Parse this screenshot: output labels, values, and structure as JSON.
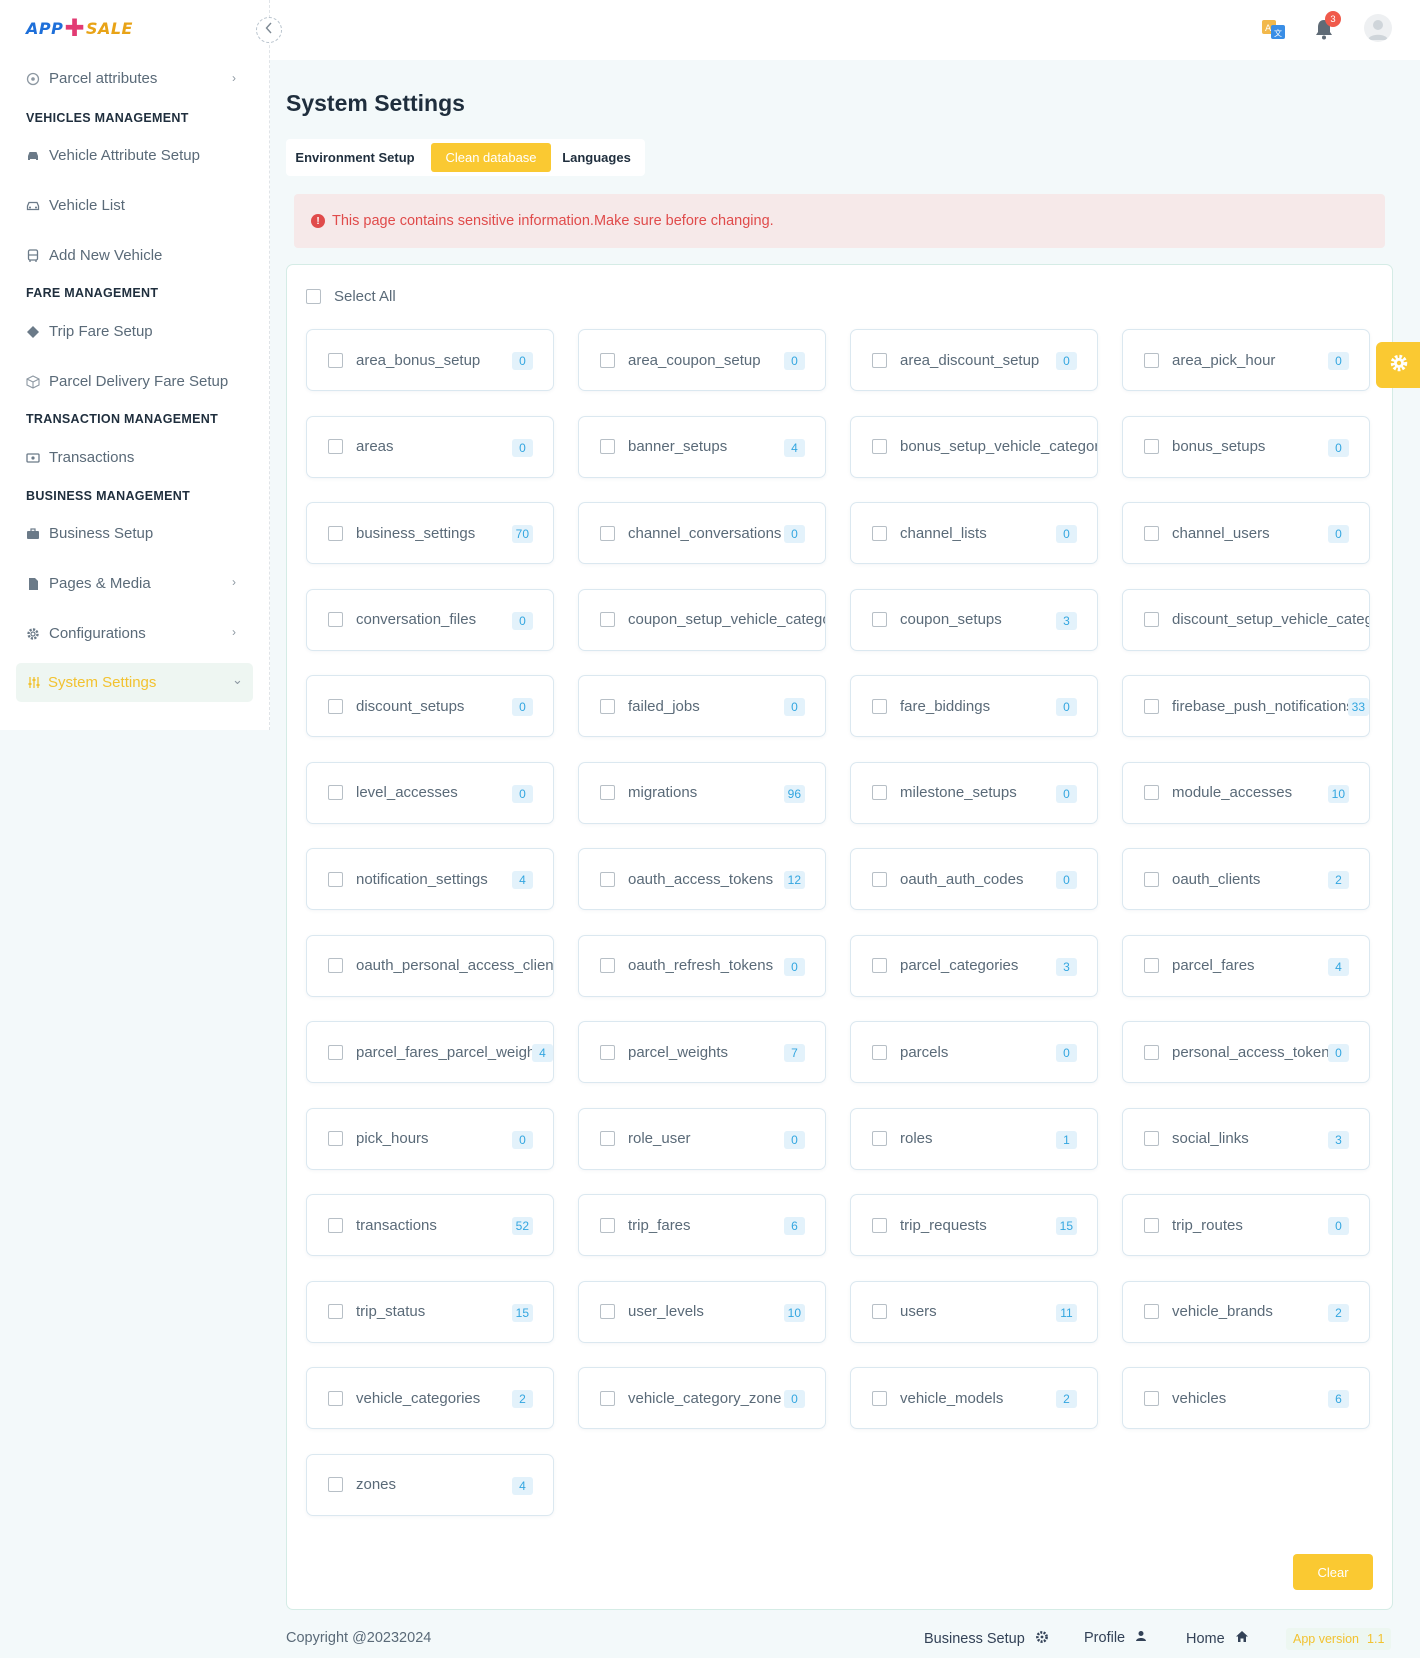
{
  "app": {
    "logo_left": "APP",
    "logo_right": "SALE"
  },
  "sidebar": {
    "items": [
      {
        "label": "Parcel attributes",
        "icon": "circle-plus-icon",
        "chevron": true
      },
      {
        "section": "VEHICLES MANAGEMENT"
      },
      {
        "label": "Vehicle Attribute Setup",
        "icon": "car-icon"
      },
      {
        "label": "Vehicle List",
        "icon": "car-front-icon"
      },
      {
        "label": "Add New Vehicle",
        "icon": "bus-icon"
      },
      {
        "section": "FARE MANAGEMENT"
      },
      {
        "label": "Trip Fare Setup",
        "icon": "diamond-icon"
      },
      {
        "label": "Parcel Delivery Fare Setup",
        "icon": "box-icon"
      },
      {
        "section": "TRANSACTION MANAGEMENT"
      },
      {
        "label": "Transactions",
        "icon": "money-icon"
      },
      {
        "section": "BUSINESS MANAGEMENT"
      },
      {
        "label": "Business Setup",
        "icon": "briefcase-icon"
      },
      {
        "label": "Pages & Media",
        "icon": "pages-icon",
        "chevron": true
      },
      {
        "label": "Configurations",
        "icon": "cog-icon",
        "chevron": true
      },
      {
        "label": "System Settings",
        "icon": "sliders-icon",
        "active": true
      }
    ]
  },
  "topbar": {
    "notification_count": "3"
  },
  "page": {
    "title": "System Settings",
    "tabs": [
      "Environment Setup",
      "Clean database",
      "Languages"
    ],
    "active_tab": "Clean database",
    "alert": "This page contains sensitive information.Make sure before changing.",
    "select_all": "Select All",
    "clear_button": "Clear"
  },
  "tables": [
    {
      "name": "area_bonus_setup",
      "count": "0"
    },
    {
      "name": "area_coupon_setup",
      "count": "0"
    },
    {
      "name": "area_discount_setup",
      "count": "0"
    },
    {
      "name": "area_pick_hour",
      "count": "0"
    },
    {
      "name": "areas",
      "count": "0"
    },
    {
      "name": "banner_setups",
      "count": "4"
    },
    {
      "name": "bonus_setup_vehicle_category",
      "count": ""
    },
    {
      "name": "bonus_setups",
      "count": "0"
    },
    {
      "name": "business_settings",
      "count": "70"
    },
    {
      "name": "channel_conversations",
      "count": "0"
    },
    {
      "name": "channel_lists",
      "count": "0"
    },
    {
      "name": "channel_users",
      "count": "0"
    },
    {
      "name": "conversation_files",
      "count": "0"
    },
    {
      "name": "coupon_setup_vehicle_categor",
      "count": ""
    },
    {
      "name": "coupon_setups",
      "count": "3"
    },
    {
      "name": "discount_setup_vehicle_catego",
      "count": ""
    },
    {
      "name": "discount_setups",
      "count": "0"
    },
    {
      "name": "failed_jobs",
      "count": "0"
    },
    {
      "name": "fare_biddings",
      "count": "0"
    },
    {
      "name": "firebase_push_notifications",
      "count": "33"
    },
    {
      "name": "level_accesses",
      "count": "0"
    },
    {
      "name": "migrations",
      "count": "96"
    },
    {
      "name": "milestone_setups",
      "count": "0"
    },
    {
      "name": "module_accesses",
      "count": "10"
    },
    {
      "name": "notification_settings",
      "count": "4"
    },
    {
      "name": "oauth_access_tokens",
      "count": "12"
    },
    {
      "name": "oauth_auth_codes",
      "count": "0"
    },
    {
      "name": "oauth_clients",
      "count": "2"
    },
    {
      "name": "oauth_personal_access_clients",
      "count": ""
    },
    {
      "name": "oauth_refresh_tokens",
      "count": "0"
    },
    {
      "name": "parcel_categories",
      "count": "3"
    },
    {
      "name": "parcel_fares",
      "count": "4"
    },
    {
      "name": "parcel_fares_parcel_weights",
      "count": "4"
    },
    {
      "name": "parcel_weights",
      "count": "7"
    },
    {
      "name": "parcels",
      "count": "0"
    },
    {
      "name": "personal_access_tokens",
      "count": "0"
    },
    {
      "name": "pick_hours",
      "count": "0"
    },
    {
      "name": "role_user",
      "count": "0"
    },
    {
      "name": "roles",
      "count": "1"
    },
    {
      "name": "social_links",
      "count": "3"
    },
    {
      "name": "transactions",
      "count": "52"
    },
    {
      "name": "trip_fares",
      "count": "6"
    },
    {
      "name": "trip_requests",
      "count": "15"
    },
    {
      "name": "trip_routes",
      "count": "0"
    },
    {
      "name": "trip_status",
      "count": "15"
    },
    {
      "name": "user_levels",
      "count": "10"
    },
    {
      "name": "users",
      "count": "11"
    },
    {
      "name": "vehicle_brands",
      "count": "2"
    },
    {
      "name": "vehicle_categories",
      "count": "2"
    },
    {
      "name": "vehicle_category_zone",
      "count": "0"
    },
    {
      "name": "vehicle_models",
      "count": "2"
    },
    {
      "name": "vehicles",
      "count": "6"
    },
    {
      "name": "zones",
      "count": "4"
    }
  ],
  "footer": {
    "copyright": "Copyright @20232024",
    "links": [
      "Business Setup",
      "Profile",
      "Home"
    ],
    "version_label": "App version",
    "version": "1.1"
  },
  "colors": {
    "accent": "#fac932",
    "badge_text": "#33a6e0",
    "alert": "#e04b4b"
  }
}
